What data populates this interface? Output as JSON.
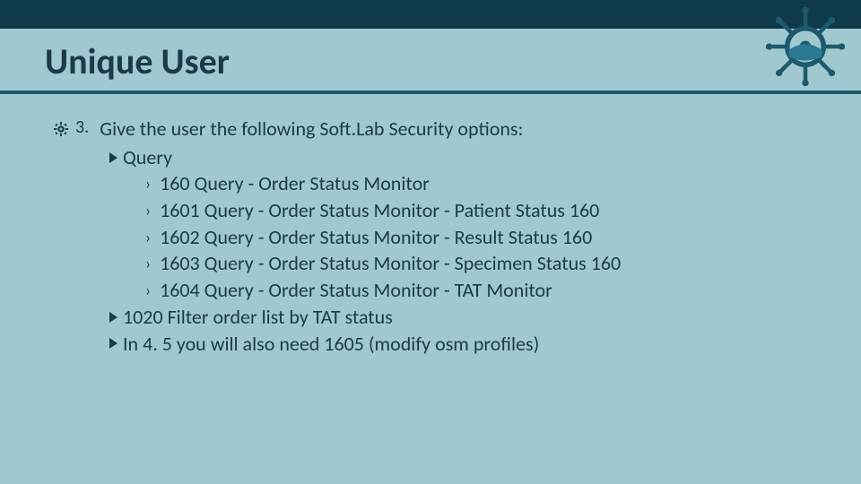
{
  "header": {
    "title": "Unique User",
    "logo_name": "ships-wheel-logo"
  },
  "content": {
    "step_number": "3.",
    "step_text": "Give the user the following Soft.Lab Security options:",
    "sections": [
      {
        "label": "Query",
        "items": [
          "160 Query - Order Status Monitor",
          "1601 Query - Order Status Monitor - Patient Status  160",
          "1602 Query - Order Status Monitor - Result Status   160",
          "1603 Query - Order Status Monitor - Specimen Status 160",
          "1604 Query - Order Status Monitor - TAT Monitor"
        ]
      },
      {
        "label": "1020 Filter order list by TAT status"
      },
      {
        "label": "In 4. 5 you will also need 1605 (modify osm profiles)"
      }
    ]
  }
}
